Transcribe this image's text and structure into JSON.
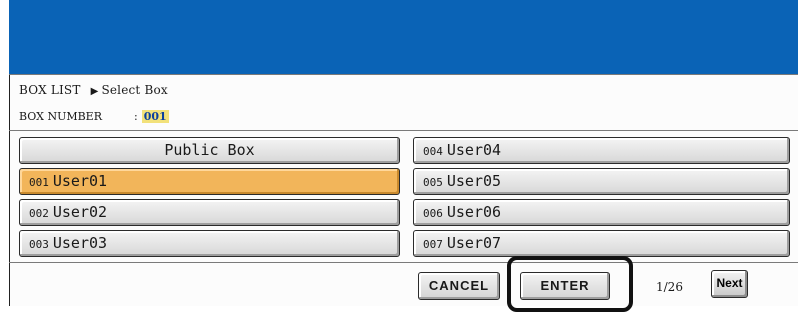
{
  "breadcrumb": {
    "root": "BOX LIST",
    "arrow": "▶",
    "current": "Select Box"
  },
  "box_number": {
    "label": "BOX NUMBER",
    "colon": ":",
    "value": "001"
  },
  "boxes": [
    {
      "num": "",
      "name": "Public Box"
    },
    {
      "num": "001",
      "name": "User01"
    },
    {
      "num": "002",
      "name": "User02"
    },
    {
      "num": "003",
      "name": "User03"
    },
    {
      "num": "004",
      "name": "User04"
    },
    {
      "num": "005",
      "name": "User05"
    },
    {
      "num": "006",
      "name": "User06"
    },
    {
      "num": "007",
      "name": "User07"
    }
  ],
  "buttons": {
    "cancel": "CANCEL",
    "enter": "ENTER",
    "next": "Next"
  },
  "pagination": {
    "label": "1/26"
  },
  "colors": {
    "header": "#0a63b6",
    "selected": "#f2b55a"
  }
}
